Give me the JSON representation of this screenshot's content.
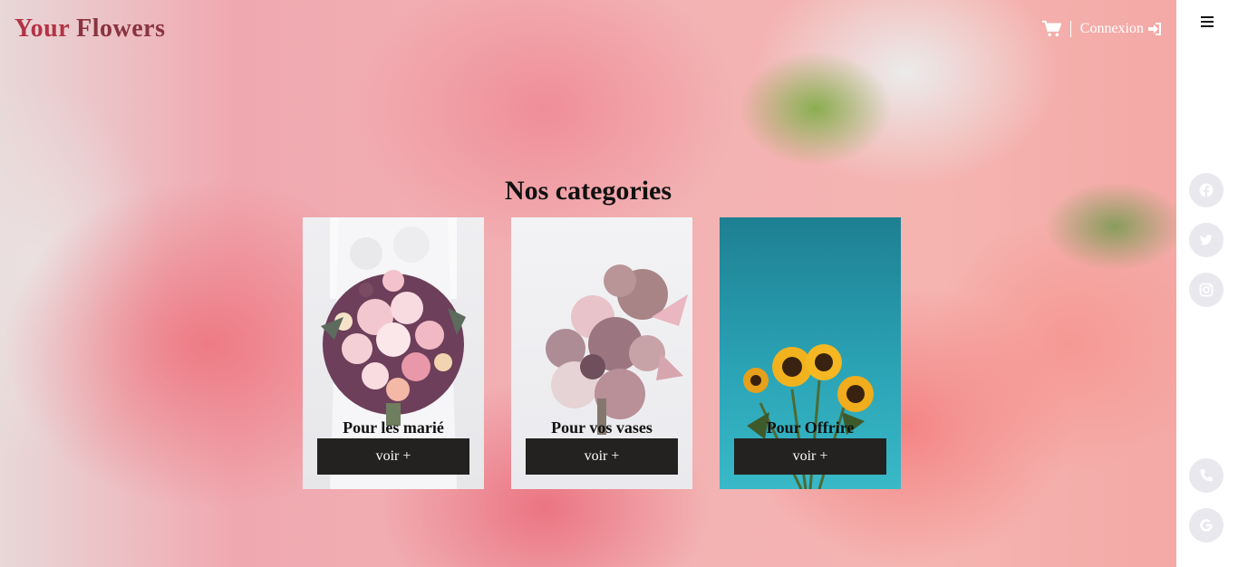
{
  "brand": {
    "part1": "Your",
    "part2": "Flowers"
  },
  "nav": {
    "login": "Connexion"
  },
  "section": {
    "title": "Nos categories"
  },
  "categories": [
    {
      "title": "Pour les marié",
      "button": "voir +"
    },
    {
      "title": "Pour vos vases",
      "button": "voir +"
    },
    {
      "title": "Pour Offrire",
      "button": "voir +"
    }
  ],
  "icons": [
    "cart-icon",
    "login-icon",
    "menu-icon",
    "facebook-icon",
    "twitter-icon",
    "instagram-icon",
    "phone-icon",
    "google-icon"
  ],
  "colors": {
    "brand": "#b33344",
    "button": "#232220",
    "rail": "#ffffff"
  }
}
